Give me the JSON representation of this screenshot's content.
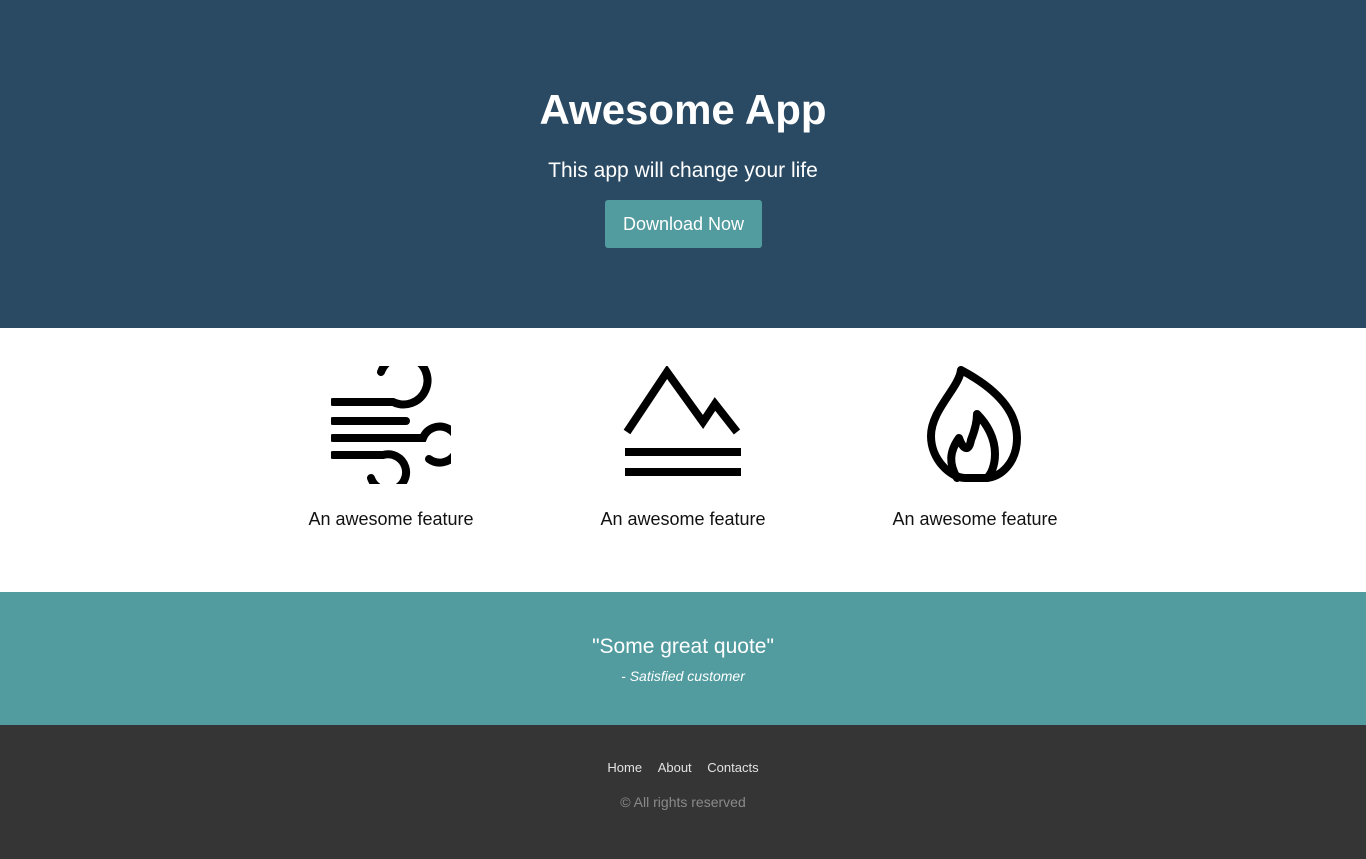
{
  "hero": {
    "title": "Awesome App",
    "subtitle": "This app will change your life",
    "cta_label": "Download Now"
  },
  "features": [
    {
      "icon": "wind-icon",
      "label": "An awesome feature"
    },
    {
      "icon": "mountain-icon",
      "label": "An awesome feature"
    },
    {
      "icon": "fire-icon",
      "label": "An awesome feature"
    }
  ],
  "testimonial": {
    "quote": "\"Some great quote\"",
    "author": "- Satisfied customer"
  },
  "footer": {
    "nav": [
      "Home",
      "About",
      "Contacts"
    ],
    "copyright": "© All rights reserved"
  },
  "colors": {
    "hero_bg": "#2a4a63",
    "accent": "#529ca0",
    "footer_bg": "#353535"
  }
}
